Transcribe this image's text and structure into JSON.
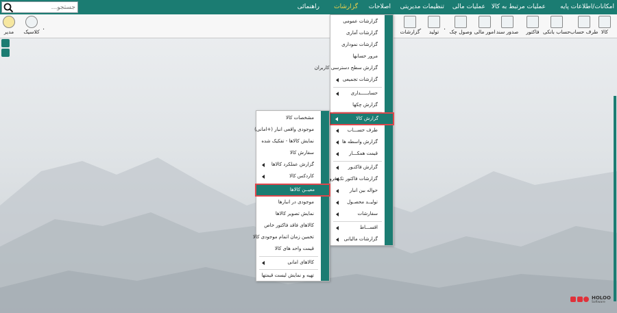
{
  "menubar": {
    "items": [
      {
        "label": "امکانات/اطلاعات پایه"
      },
      {
        "label": "عملیات مرتبط به کالا"
      },
      {
        "label": "عملیات مالی"
      },
      {
        "label": "تنظیمات مدیریتی"
      },
      {
        "label": "اصلاحات"
      },
      {
        "label": "گزارشات"
      },
      {
        "label": "راهنمائی"
      }
    ],
    "search_placeholder": "جستجو..."
  },
  "toolbar": {
    "buttons": [
      {
        "label": "کالا"
      },
      {
        "label": "طرف حساب"
      },
      {
        "label": "حساب بانکی"
      },
      {
        "label": "فاکتور"
      },
      {
        "label": "صدور سند"
      },
      {
        "label": "امور مالی"
      },
      {
        "label": "وصول چک"
      },
      {
        "label": "تولید"
      },
      {
        "label": "گزارشات"
      },
      {
        "label": "کلاسیک"
      },
      {
        "label": "مدیر"
      }
    ]
  },
  "reports_menu": {
    "items": [
      {
        "label": "گزارشات عمومی",
        "submenu": false
      },
      {
        "label": "گزارشات آماری",
        "submenu": false
      },
      {
        "label": "گزارشات نموداری",
        "submenu": false
      },
      {
        "label": "مرور حسابها",
        "submenu": false
      },
      {
        "label": "گزارش سطح دسترسی کاربران",
        "submenu": false
      },
      {
        "label": "گزارشات تجمیعی",
        "submenu": true
      },
      {
        "label": "حسابـــــداری",
        "submenu": true
      },
      {
        "label": "گزارش چکها",
        "submenu": false
      },
      {
        "label": "گزارش کالا",
        "submenu": true
      },
      {
        "label": "طرف حســـاب",
        "submenu": true
      },
      {
        "label": "گزارش واسطه ها",
        "submenu": true
      },
      {
        "label": "قیمت همکـــار",
        "submenu": true
      },
      {
        "label": "گزارش فاکتـور",
        "submenu": true
      },
      {
        "label": "گزارشات فاکتور تک فروشی",
        "submenu": true
      },
      {
        "label": "حواله بین انبار",
        "submenu": true
      },
      {
        "label": "تولیــد محصـول",
        "submenu": true
      },
      {
        "label": "سفارشات",
        "submenu": true
      },
      {
        "label": "اقســـاط",
        "submenu": true
      },
      {
        "label": "گزارشات مالیاتی",
        "submenu": true
      }
    ]
  },
  "goods_menu": {
    "items": [
      {
        "label": "مشخصات کالا",
        "submenu": false
      },
      {
        "label": "موجودی واقعی انبار (+امانی)",
        "submenu": false
      },
      {
        "label": "نمایش کالاها - تفکیک شده",
        "submenu": false
      },
      {
        "label": "سفارش کالا",
        "submenu": false
      },
      {
        "label": "گزارش عملکرد کالاها",
        "submenu": true
      },
      {
        "label": "کاردکس کالا",
        "submenu": true
      },
      {
        "label": "معیــن کالاها",
        "submenu": false
      },
      {
        "label": "موجودی در انبارها",
        "submenu": false
      },
      {
        "label": "نمایش تصویر کالاها",
        "submenu": false
      },
      {
        "label": "کالاهای فاقد فاکتور خاص",
        "submenu": false
      },
      {
        "label": "تخمین زمان اتمام موجودی کالا",
        "submenu": false
      },
      {
        "label": "قیمت واحد های کالا",
        "submenu": false
      },
      {
        "label": "کالاهای امانی",
        "submenu": true
      },
      {
        "label": "تهیه و نمایش لیست قیمتها",
        "submenu": false
      }
    ]
  },
  "logo": {
    "text": "HOLOO",
    "subtext": "Software"
  },
  "colors": {
    "accent": "#1b7c72",
    "highlight_border": "#e0474c",
    "active_menu": "#f5d54a"
  }
}
